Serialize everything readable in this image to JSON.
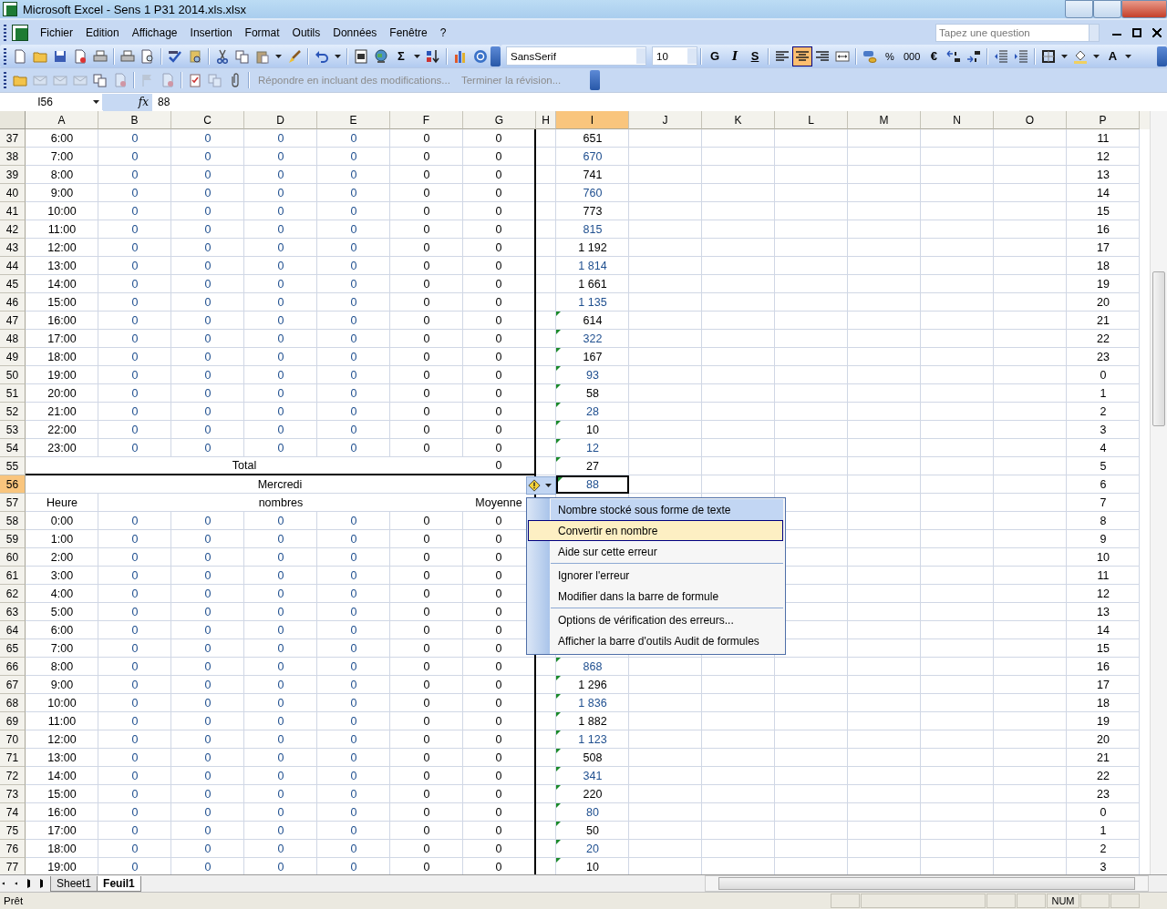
{
  "window": {
    "title": "Microsoft Excel - Sens 1 P31 2014.xls.xlsx"
  },
  "menu_bar": {
    "items": [
      "Fichier",
      "Edition",
      "Affichage",
      "Insertion",
      "Format",
      "Outils",
      "Données",
      "Fenêtre",
      "?"
    ],
    "question_placeholder": "Tapez une question"
  },
  "standard_toolbar": [
    {
      "kind": "icon"
    },
    {
      "kind": "icon"
    },
    {
      "kind": "icon"
    },
    {
      "kind": "icon"
    },
    {
      "kind": "icon"
    },
    {
      "kind": "separator"
    },
    {
      "kind": "icon"
    },
    {
      "kind": "icon"
    },
    {
      "kind": "separator"
    },
    {
      "kind": "icon"
    },
    {
      "kind": "icon"
    },
    {
      "kind": "separator"
    },
    {
      "kind": "icon"
    },
    {
      "kind": "icon"
    },
    {
      "kind": "icon"
    },
    {
      "kind": "caret"
    },
    {
      "kind": "icon"
    },
    {
      "kind": "separator"
    },
    {
      "kind": "icon"
    },
    {
      "kind": "caret"
    },
    {
      "kind": "separator"
    },
    {
      "kind": "icon"
    },
    {
      "kind": "icon"
    },
    {
      "kind": "glyph",
      "text": "Σ"
    },
    {
      "kind": "caret"
    },
    {
      "kind": "icon"
    },
    {
      "kind": "separator"
    },
    {
      "kind": "icon"
    },
    {
      "kind": "icon"
    }
  ],
  "formatting_toolbar": {
    "font": "SansSerif",
    "size": "10",
    "buttons": [
      {
        "kind": "glyph",
        "text": "G",
        "selected": false
      },
      {
        "kind": "glyph",
        "text": "I",
        "selected": false
      },
      {
        "kind": "glyph",
        "text": "S",
        "selected": false
      },
      {
        "kind": "separator"
      },
      {
        "kind": "icon",
        "selected": false
      },
      {
        "kind": "icon",
        "selected": true
      },
      {
        "kind": "icon",
        "selected": false
      },
      {
        "kind": "icon",
        "selected": false
      },
      {
        "kind": "separator"
      },
      {
        "kind": "icon",
        "selected": false
      },
      {
        "kind": "glyph",
        "text": "%",
        "selected": false
      },
      {
        "kind": "glyph",
        "text": "000",
        "selected": false
      },
      {
        "kind": "glyph",
        "text": "€",
        "selected": false
      },
      {
        "kind": "icon",
        "selected": false
      },
      {
        "kind": "icon",
        "selected": false
      },
      {
        "kind": "separator"
      },
      {
        "kind": "icon",
        "selected": false
      },
      {
        "kind": "icon",
        "selected": false
      },
      {
        "kind": "separator"
      },
      {
        "kind": "icon",
        "selected": false
      },
      {
        "kind": "caret"
      },
      {
        "kind": "icon",
        "selected": false
      },
      {
        "kind": "caret"
      },
      {
        "kind": "glyph",
        "text": "A",
        "selected": false
      },
      {
        "kind": "caret"
      }
    ]
  },
  "review_toolbar": {
    "items": [
      {
        "kind": "icon",
        "disabled": false
      },
      {
        "kind": "icon",
        "disabled": true
      },
      {
        "kind": "icon",
        "disabled": true
      },
      {
        "kind": "icon",
        "disabled": true
      },
      {
        "kind": "icon",
        "disabled": false
      },
      {
        "kind": "icon",
        "disabled": true
      },
      {
        "kind": "separator"
      },
      {
        "kind": "icon",
        "disabled": true
      },
      {
        "kind": "icon",
        "disabled": true
      },
      {
        "kind": "separator"
      },
      {
        "kind": "icon",
        "disabled": false
      },
      {
        "kind": "icon",
        "disabled": true
      },
      {
        "kind": "icon",
        "disabled": false
      },
      {
        "kind": "separator"
      },
      {
        "kind": "text",
        "text": "Répondre en incluant des modifications...",
        "disabled": true
      },
      {
        "kind": "text",
        "text": "Terminer la révision...",
        "disabled": true
      }
    ]
  },
  "formula_bar": {
    "name_box": "I56",
    "fx": "fx",
    "value": "88"
  },
  "columns": [
    {
      "label": "A",
      "selected": false
    },
    {
      "label": "B",
      "selected": false
    },
    {
      "label": "C",
      "selected": false
    },
    {
      "label": "D",
      "selected": false
    },
    {
      "label": "E",
      "selected": false
    },
    {
      "label": "F",
      "selected": false
    },
    {
      "label": "G",
      "selected": false
    },
    {
      "label": "H",
      "selected": false
    },
    {
      "label": "I",
      "selected": true
    },
    {
      "label": "J",
      "selected": false
    },
    {
      "label": "K",
      "selected": false
    },
    {
      "label": "L",
      "selected": false
    },
    {
      "label": "M",
      "selected": false
    },
    {
      "label": "N",
      "selected": false
    },
    {
      "label": "O",
      "selected": false
    },
    {
      "label": "P",
      "selected": false
    }
  ],
  "rows": [
    {
      "n": "37",
      "kind": "hour",
      "selected": false,
      "hour": "6:00",
      "values": [
        "0",
        "0",
        "0",
        "0",
        "0"
      ],
      "mean": "0",
      "i": {
        "text": "651",
        "color": "#000000",
        "flagged": false
      },
      "p": "11"
    },
    {
      "n": "38",
      "kind": "hour",
      "selected": false,
      "hour": "7:00",
      "values": [
        "0",
        "0",
        "0",
        "0",
        "0"
      ],
      "mean": "0",
      "i": {
        "text": "670",
        "color": "#1f4f8f",
        "flagged": false
      },
      "p": "12"
    },
    {
      "n": "39",
      "kind": "hour",
      "selected": false,
      "hour": "8:00",
      "values": [
        "0",
        "0",
        "0",
        "0",
        "0"
      ],
      "mean": "0",
      "i": {
        "text": "741",
        "color": "#000000",
        "flagged": false
      },
      "p": "13"
    },
    {
      "n": "40",
      "kind": "hour",
      "selected": false,
      "hour": "9:00",
      "values": [
        "0",
        "0",
        "0",
        "0",
        "0"
      ],
      "mean": "0",
      "i": {
        "text": "760",
        "color": "#1f4f8f",
        "flagged": false
      },
      "p": "14"
    },
    {
      "n": "41",
      "kind": "hour",
      "selected": false,
      "hour": "10:00",
      "values": [
        "0",
        "0",
        "0",
        "0",
        "0"
      ],
      "mean": "0",
      "i": {
        "text": "773",
        "color": "#000000",
        "flagged": false
      },
      "p": "15"
    },
    {
      "n": "42",
      "kind": "hour",
      "selected": false,
      "hour": "11:00",
      "values": [
        "0",
        "0",
        "0",
        "0",
        "0"
      ],
      "mean": "0",
      "i": {
        "text": "815",
        "color": "#1f4f8f",
        "flagged": false
      },
      "p": "16"
    },
    {
      "n": "43",
      "kind": "hour",
      "selected": false,
      "hour": "12:00",
      "values": [
        "0",
        "0",
        "0",
        "0",
        "0"
      ],
      "mean": "0",
      "i": {
        "text": "1 192",
        "color": "#000000",
        "flagged": false
      },
      "p": "17"
    },
    {
      "n": "44",
      "kind": "hour",
      "selected": false,
      "hour": "13:00",
      "values": [
        "0",
        "0",
        "0",
        "0",
        "0"
      ],
      "mean": "0",
      "i": {
        "text": "1 814",
        "color": "#1f4f8f",
        "flagged": false
      },
      "p": "18"
    },
    {
      "n": "45",
      "kind": "hour",
      "selected": false,
      "hour": "14:00",
      "values": [
        "0",
        "0",
        "0",
        "0",
        "0"
      ],
      "mean": "0",
      "i": {
        "text": "1 661",
        "color": "#000000",
        "flagged": false
      },
      "p": "19"
    },
    {
      "n": "46",
      "kind": "hour",
      "selected": false,
      "hour": "15:00",
      "values": [
        "0",
        "0",
        "0",
        "0",
        "0"
      ],
      "mean": "0",
      "i": {
        "text": "1 135",
        "color": "#1f4f8f",
        "flagged": false
      },
      "p": "20"
    },
    {
      "n": "47",
      "kind": "hour",
      "selected": false,
      "hour": "16:00",
      "values": [
        "0",
        "0",
        "0",
        "0",
        "0"
      ],
      "mean": "0",
      "i": {
        "text": "614",
        "color": "#000000",
        "flagged": true
      },
      "p": "21"
    },
    {
      "n": "48",
      "kind": "hour",
      "selected": false,
      "hour": "17:00",
      "values": [
        "0",
        "0",
        "0",
        "0",
        "0"
      ],
      "mean": "0",
      "i": {
        "text": "322",
        "color": "#1f4f8f",
        "flagged": true
      },
      "p": "22"
    },
    {
      "n": "49",
      "kind": "hour",
      "selected": false,
      "hour": "18:00",
      "values": [
        "0",
        "0",
        "0",
        "0",
        "0"
      ],
      "mean": "0",
      "i": {
        "text": "167",
        "color": "#000000",
        "flagged": true
      },
      "p": "23"
    },
    {
      "n": "50",
      "kind": "hour",
      "selected": false,
      "hour": "19:00",
      "values": [
        "0",
        "0",
        "0",
        "0",
        "0"
      ],
      "mean": "0",
      "i": {
        "text": "93",
        "color": "#1f4f8f",
        "flagged": true
      },
      "p": "0"
    },
    {
      "n": "51",
      "kind": "hour",
      "selected": false,
      "hour": "20:00",
      "values": [
        "0",
        "0",
        "0",
        "0",
        "0"
      ],
      "mean": "0",
      "i": {
        "text": "58",
        "color": "#000000",
        "flagged": true
      },
      "p": "1"
    },
    {
      "n": "52",
      "kind": "hour",
      "selected": false,
      "hour": "21:00",
      "values": [
        "0",
        "0",
        "0",
        "0",
        "0"
      ],
      "mean": "0",
      "i": {
        "text": "28",
        "color": "#1f4f8f",
        "flagged": true
      },
      "p": "2"
    },
    {
      "n": "53",
      "kind": "hour",
      "selected": false,
      "hour": "22:00",
      "values": [
        "0",
        "0",
        "0",
        "0",
        "0"
      ],
      "mean": "0",
      "i": {
        "text": "10",
        "color": "#000000",
        "flagged": true
      },
      "p": "3"
    },
    {
      "n": "54",
      "kind": "hour",
      "selected": false,
      "hour": "23:00",
      "values": [
        "0",
        "0",
        "0",
        "0",
        "0"
      ],
      "mean": "0",
      "i": {
        "text": "12",
        "color": "#1f4f8f",
        "flagged": true
      },
      "p": "4"
    },
    {
      "n": "55",
      "kind": "total",
      "selected": false,
      "total_label": "Total",
      "mean": "0",
      "i": {
        "text": "27",
        "color": "#000000",
        "flagged": true
      },
      "p": "5"
    },
    {
      "n": "56",
      "kind": "day",
      "selected": true,
      "day_label": "Mercredi",
      "i": {
        "text": "88",
        "color": "#1f4f8f",
        "flagged": true
      },
      "p": "6"
    },
    {
      "n": "57",
      "kind": "header",
      "selected": false,
      "hour": "Heure",
      "values_label": "nombres",
      "mean": "Moyenne",
      "p": "7"
    },
    {
      "n": "58",
      "kind": "hour",
      "selected": false,
      "hour": "0:00",
      "values": [
        "0",
        "0",
        "0",
        "0",
        "0"
      ],
      "mean": "0",
      "p": "8"
    },
    {
      "n": "59",
      "kind": "hour",
      "selected": false,
      "hour": "1:00",
      "values": [
        "0",
        "0",
        "0",
        "0",
        "0"
      ],
      "mean": "0",
      "p": "9"
    },
    {
      "n": "60",
      "kind": "hour",
      "selected": false,
      "hour": "2:00",
      "values": [
        "0",
        "0",
        "0",
        "0",
        "0"
      ],
      "mean": "0",
      "p": "10"
    },
    {
      "n": "61",
      "kind": "hour",
      "selected": false,
      "hour": "3:00",
      "values": [
        "0",
        "0",
        "0",
        "0",
        "0"
      ],
      "mean": "0",
      "p": "11"
    },
    {
      "n": "62",
      "kind": "hour",
      "selected": false,
      "hour": "4:00",
      "values": [
        "0",
        "0",
        "0",
        "0",
        "0"
      ],
      "mean": "0",
      "p": "12"
    },
    {
      "n": "63",
      "kind": "hour",
      "selected": false,
      "hour": "5:00",
      "values": [
        "0",
        "0",
        "0",
        "0",
        "0"
      ],
      "mean": "0",
      "p": "13"
    },
    {
      "n": "64",
      "kind": "hour",
      "selected": false,
      "hour": "6:00",
      "values": [
        "0",
        "0",
        "0",
        "0",
        "0"
      ],
      "mean": "0",
      "p": "14"
    },
    {
      "n": "65",
      "kind": "hour",
      "selected": false,
      "hour": "7:00",
      "values": [
        "0",
        "0",
        "0",
        "0",
        "0"
      ],
      "mean": "0",
      "p": "15"
    },
    {
      "n": "66",
      "kind": "hour",
      "selected": false,
      "hour": "8:00",
      "values": [
        "0",
        "0",
        "0",
        "0",
        "0"
      ],
      "mean": "0",
      "i": {
        "text": "868",
        "color": "#1f4f8f",
        "flagged": true
      },
      "p": "16"
    },
    {
      "n": "67",
      "kind": "hour",
      "selected": false,
      "hour": "9:00",
      "values": [
        "0",
        "0",
        "0",
        "0",
        "0"
      ],
      "mean": "0",
      "i": {
        "text": "1 296",
        "color": "#000000",
        "flagged": true
      },
      "p": "17"
    },
    {
      "n": "68",
      "kind": "hour",
      "selected": false,
      "hour": "10:00",
      "values": [
        "0",
        "0",
        "0",
        "0",
        "0"
      ],
      "mean": "0",
      "i": {
        "text": "1 836",
        "color": "#1f4f8f",
        "flagged": true
      },
      "p": "18"
    },
    {
      "n": "69",
      "kind": "hour",
      "selected": false,
      "hour": "11:00",
      "values": [
        "0",
        "0",
        "0",
        "0",
        "0"
      ],
      "mean": "0",
      "i": {
        "text": "1 882",
        "color": "#000000",
        "flagged": true
      },
      "p": "19"
    },
    {
      "n": "70",
      "kind": "hour",
      "selected": false,
      "hour": "12:00",
      "values": [
        "0",
        "0",
        "0",
        "0",
        "0"
      ],
      "mean": "0",
      "i": {
        "text": "1 123",
        "color": "#1f4f8f",
        "flagged": true
      },
      "p": "20"
    },
    {
      "n": "71",
      "kind": "hour",
      "selected": false,
      "hour": "13:00",
      "values": [
        "0",
        "0",
        "0",
        "0",
        "0"
      ],
      "mean": "0",
      "i": {
        "text": "508",
        "color": "#000000",
        "flagged": true
      },
      "p": "21"
    },
    {
      "n": "72",
      "kind": "hour",
      "selected": false,
      "hour": "14:00",
      "values": [
        "0",
        "0",
        "0",
        "0",
        "0"
      ],
      "mean": "0",
      "i": {
        "text": "341",
        "color": "#1f4f8f",
        "flagged": true
      },
      "p": "22"
    },
    {
      "n": "73",
      "kind": "hour",
      "selected": false,
      "hour": "15:00",
      "values": [
        "0",
        "0",
        "0",
        "0",
        "0"
      ],
      "mean": "0",
      "i": {
        "text": "220",
        "color": "#000000",
        "flagged": true
      },
      "p": "23"
    },
    {
      "n": "74",
      "kind": "hour",
      "selected": false,
      "hour": "16:00",
      "values": [
        "0",
        "0",
        "0",
        "0",
        "0"
      ],
      "mean": "0",
      "i": {
        "text": "80",
        "color": "#1f4f8f",
        "flagged": true
      },
      "p": "0"
    },
    {
      "n": "75",
      "kind": "hour",
      "selected": false,
      "hour": "17:00",
      "values": [
        "0",
        "0",
        "0",
        "0",
        "0"
      ],
      "mean": "0",
      "i": {
        "text": "50",
        "color": "#000000",
        "flagged": true
      },
      "p": "1"
    },
    {
      "n": "76",
      "kind": "hour",
      "selected": false,
      "hour": "18:00",
      "values": [
        "0",
        "0",
        "0",
        "0",
        "0"
      ],
      "mean": "0",
      "i": {
        "text": "20",
        "color": "#1f4f8f",
        "flagged": true
      },
      "p": "2"
    },
    {
      "n": "77",
      "kind": "hour",
      "selected": false,
      "hour": "19:00",
      "values": [
        "0",
        "0",
        "0",
        "0",
        "0"
      ],
      "mean": "0",
      "i": {
        "text": "10",
        "color": "#000000",
        "flagged": true
      },
      "p": "3"
    }
  ],
  "error_menu": {
    "expanded": true,
    "items": [
      {
        "kind": "title",
        "text": "Nombre stocké sous forme de texte"
      },
      {
        "kind": "item",
        "text": "Convertir en nombre",
        "selected": true
      },
      {
        "kind": "item",
        "text": "Aide sur cette erreur",
        "selected": false
      },
      {
        "kind": "separator"
      },
      {
        "kind": "item",
        "text": "Ignorer l'erreur",
        "selected": false
      },
      {
        "kind": "item",
        "text": "Modifier dans la barre de formule",
        "selected": false
      },
      {
        "kind": "separator"
      },
      {
        "kind": "item",
        "text": "Options de vérification des erreurs...",
        "selected": false
      },
      {
        "kind": "item",
        "text": "Afficher la barre d'outils Audit de formules",
        "selected": false
      }
    ]
  },
  "sheet_tabs": [
    {
      "label": "Sheet1",
      "selected": false
    },
    {
      "label": "Feuil1",
      "selected": true
    }
  ],
  "status_bar": {
    "status": "Prêt",
    "num": "NUM"
  }
}
